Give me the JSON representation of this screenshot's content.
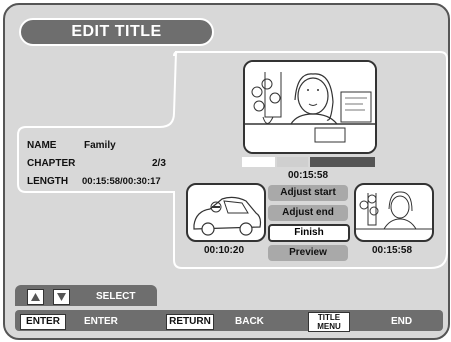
{
  "screen": {
    "title": "EDIT TITLE"
  },
  "info": {
    "name_label": "NAME",
    "name_value": "Family",
    "chapter_label": "CHAPTER",
    "chapter_value": "2/3",
    "length_label": "LENGTH",
    "length_value": "00:15:58/00:30:17"
  },
  "preview": {
    "current_time": "00:15:58",
    "progress_fraction": 0.5
  },
  "thumbnails": {
    "start_time": "00:10:20",
    "end_time": "00:15:58"
  },
  "menu": {
    "adjust_start": "Adjust start",
    "adjust_end": "Adjust end",
    "finish": "Finish",
    "preview": "Preview",
    "selected": "Finish"
  },
  "footer": {
    "select_label": "SELECT",
    "enter_key": "ENTER",
    "enter_label": "ENTER",
    "return_key": "RETURN",
    "back_label": "BACK",
    "title_menu_key_line1": "TITLE",
    "title_menu_key_line2": "MENU",
    "end_label": "END"
  },
  "colors": {
    "panel_bg": "#d8d8d8",
    "pill_bg": "#6e6e6e",
    "button_dim": "#a9a9a9",
    "progress_dark": "#555555"
  }
}
